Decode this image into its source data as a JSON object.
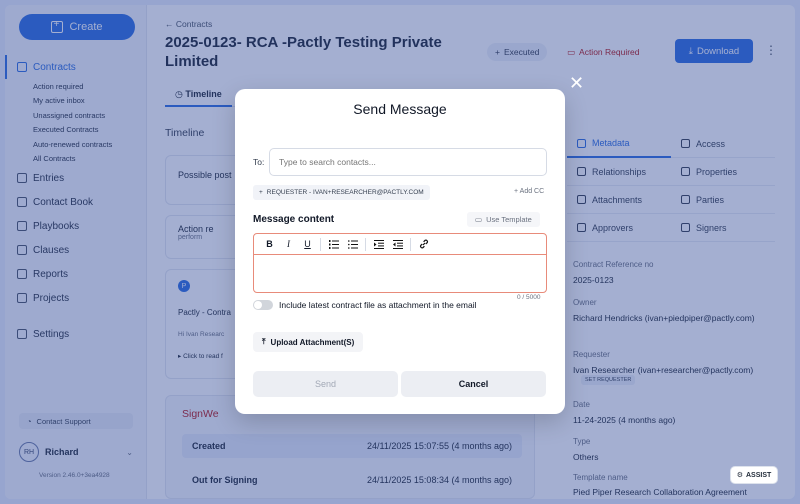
{
  "sidebar": {
    "create_label": "Create",
    "nav": [
      {
        "label": "Contracts",
        "icon": "contract-icon"
      },
      {
        "label": "Entries",
        "icon": "entries-icon"
      },
      {
        "label": "Contact Book",
        "icon": "contact-book-icon"
      },
      {
        "label": "Playbooks",
        "icon": "playbook-icon"
      },
      {
        "label": "Clauses",
        "icon": "clause-icon"
      },
      {
        "label": "Reports",
        "icon": "report-icon"
      },
      {
        "label": "Projects",
        "icon": "project-icon"
      },
      {
        "label": "Settings",
        "icon": "settings-icon"
      }
    ],
    "sub_items": [
      "Action required",
      "My active inbox",
      "Unassigned contracts",
      "Executed Contracts",
      "Auto-renewed contracts",
      "All Contracts"
    ],
    "support_label": "Contact Support",
    "user": {
      "initials": "RH",
      "name": "Richard"
    },
    "version": "Version 2.46.0+3ea4928"
  },
  "header": {
    "back_label": "Contracts",
    "title": "2025-0123- RCA -Pactly Testing Private Limited",
    "status_executed": "Executed",
    "status_action": "Action Required",
    "download_label": "Download",
    "kebab": "⋮"
  },
  "tabs": {
    "timeline_label": "Timeline"
  },
  "timeline": {
    "section_title": "Timeline",
    "card1_text": "Possible post",
    "card2_text": "Action re",
    "card2_sub": "perform",
    "card3_sender_initial": "P",
    "card3_head": "Pactly - Contra",
    "card3_body": "Hi Ivan Researc",
    "card3_link": "▸ Click to read f"
  },
  "signwell": {
    "title": "SignWe",
    "rows": [
      {
        "label": "Created",
        "time": "24/11/2025 15:07:55 (4 months ago)"
      },
      {
        "label": "Out for Signing",
        "time": "24/11/2025 15:08:34 (4 months ago)"
      }
    ]
  },
  "right_panel": {
    "tabs": [
      {
        "label": "Metadata"
      },
      {
        "label": "Access"
      },
      {
        "label": "Relationships"
      },
      {
        "label": "Properties"
      },
      {
        "label": "Attachments"
      },
      {
        "label": "Parties"
      },
      {
        "label": "Approvers"
      },
      {
        "label": "Signers"
      }
    ],
    "fields": [
      {
        "label": "Contract Reference no",
        "value": "2025-0123"
      },
      {
        "label": "Owner",
        "value": "Richard Hendricks (ivan+piedpiper@pactly.com)"
      },
      {
        "label": "Requester",
        "value": "Ivan Researcher (ivan+researcher@pactly.com)"
      },
      {
        "label": "Date",
        "value": "11-24-2025 (4 months ago)"
      },
      {
        "label": "Type",
        "value": "Others"
      },
      {
        "label": "Template name",
        "value": "Pied Piper Research Collaboration Agreement"
      }
    ],
    "requester_badge": "SET REQUESTER"
  },
  "assist_label": "ASSIST",
  "modal": {
    "title": "Send Message",
    "to_label": "To:",
    "to_placeholder": "Type to search contacts...",
    "chip_label": "REQUESTER - IVAN+RESEARCHER@PACTLY.COM",
    "add_cc": "+ Add CC",
    "content_label": "Message content",
    "use_template": "Use Template",
    "toolbar": {
      "bold": "B",
      "italic": "I",
      "underline": "U"
    },
    "counter": "0 / 5000",
    "attach_toggle_label": "Include latest contract file as attachment in the email",
    "upload_label": "Upload Attachment(S)",
    "send_label": "Send",
    "cancel_label": "Cancel",
    "close": "✕"
  }
}
